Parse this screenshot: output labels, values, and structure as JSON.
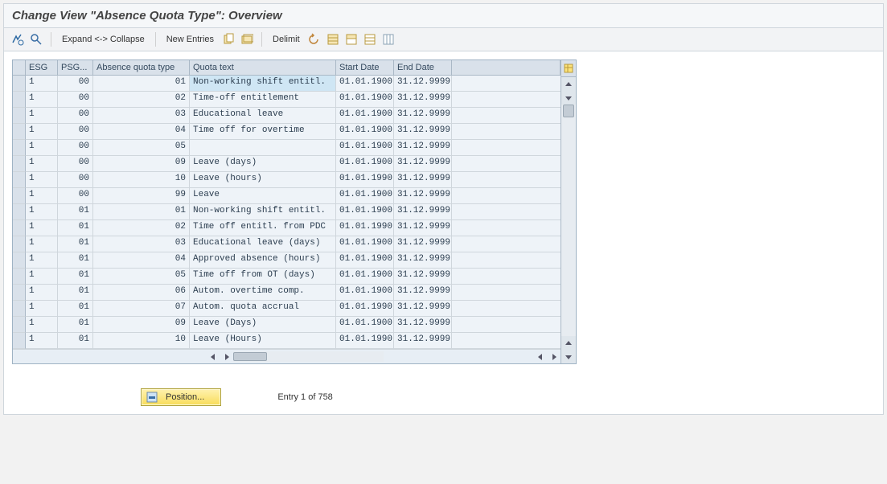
{
  "header": {
    "title": "Change View \"Absence Quota Type\": Overview"
  },
  "toolbar": {
    "expand_collapse": "Expand <-> Collapse",
    "new_entries": "New Entries",
    "delimit": "Delimit"
  },
  "table": {
    "columns": {
      "esg": "ESG",
      "psg": "PSG...",
      "aqt": "Absence quota type",
      "qt": "Quota text",
      "sd": "Start Date",
      "ed": "End Date"
    },
    "rows": [
      {
        "esg": "1",
        "psg": "00",
        "aqt": "01",
        "qt": "Non-working shift entitl.",
        "sd": "01.01.1900",
        "ed": "31.12.9999",
        "sel": true
      },
      {
        "esg": "1",
        "psg": "00",
        "aqt": "02",
        "qt": "Time-off entitlement",
        "sd": "01.01.1900",
        "ed": "31.12.9999"
      },
      {
        "esg": "1",
        "psg": "00",
        "aqt": "03",
        "qt": "Educational leave",
        "sd": "01.01.1900",
        "ed": "31.12.9999"
      },
      {
        "esg": "1",
        "psg": "00",
        "aqt": "04",
        "qt": "Time off for overtime",
        "sd": "01.01.1900",
        "ed": "31.12.9999"
      },
      {
        "esg": "1",
        "psg": "00",
        "aqt": "05",
        "qt": "",
        "sd": "01.01.1900",
        "ed": "31.12.9999"
      },
      {
        "esg": "1",
        "psg": "00",
        "aqt": "09",
        "qt": "Leave (days)",
        "sd": "01.01.1900",
        "ed": "31.12.9999"
      },
      {
        "esg": "1",
        "psg": "00",
        "aqt": "10",
        "qt": "Leave (hours)",
        "sd": "01.01.1990",
        "ed": "31.12.9999"
      },
      {
        "esg": "1",
        "psg": "00",
        "aqt": "99",
        "qt": "Leave",
        "sd": "01.01.1900",
        "ed": "31.12.9999"
      },
      {
        "esg": "1",
        "psg": "01",
        "aqt": "01",
        "qt": "Non-working shift entitl.",
        "sd": "01.01.1900",
        "ed": "31.12.9999"
      },
      {
        "esg": "1",
        "psg": "01",
        "aqt": "02",
        "qt": "Time off entitl. from PDC",
        "sd": "01.01.1990",
        "ed": "31.12.9999"
      },
      {
        "esg": "1",
        "psg": "01",
        "aqt": "03",
        "qt": "Educational leave (days)",
        "sd": "01.01.1900",
        "ed": "31.12.9999"
      },
      {
        "esg": "1",
        "psg": "01",
        "aqt": "04",
        "qt": "Approved absence (hours)",
        "sd": "01.01.1900",
        "ed": "31.12.9999"
      },
      {
        "esg": "1",
        "psg": "01",
        "aqt": "05",
        "qt": "Time off from OT (days)",
        "sd": "01.01.1900",
        "ed": "31.12.9999"
      },
      {
        "esg": "1",
        "psg": "01",
        "aqt": "06",
        "qt": "Autom. overtime comp.",
        "sd": "01.01.1900",
        "ed": "31.12.9999"
      },
      {
        "esg": "1",
        "psg": "01",
        "aqt": "07",
        "qt": "Autom. quota accrual",
        "sd": "01.01.1990",
        "ed": "31.12.9999"
      },
      {
        "esg": "1",
        "psg": "01",
        "aqt": "09",
        "qt": "Leave (Days)",
        "sd": "01.01.1900",
        "ed": "31.12.9999"
      },
      {
        "esg": "1",
        "psg": "01",
        "aqt": "10",
        "qt": "Leave (Hours)",
        "sd": "01.01.1990",
        "ed": "31.12.9999"
      }
    ]
  },
  "footer": {
    "position_label": "Position...",
    "entry_status": "Entry 1 of 758"
  },
  "icons": {
    "toggle": "toggle-display-change-icon",
    "find": "find-icon",
    "copy": "copy-icon",
    "copy_all": "copy-all-icon",
    "undo": "undo-icon",
    "select_all": "select-all-icon",
    "select_block": "select-block-icon",
    "deselect": "deselect-all-icon",
    "config": "configuration-icon",
    "position": "position-icon"
  }
}
